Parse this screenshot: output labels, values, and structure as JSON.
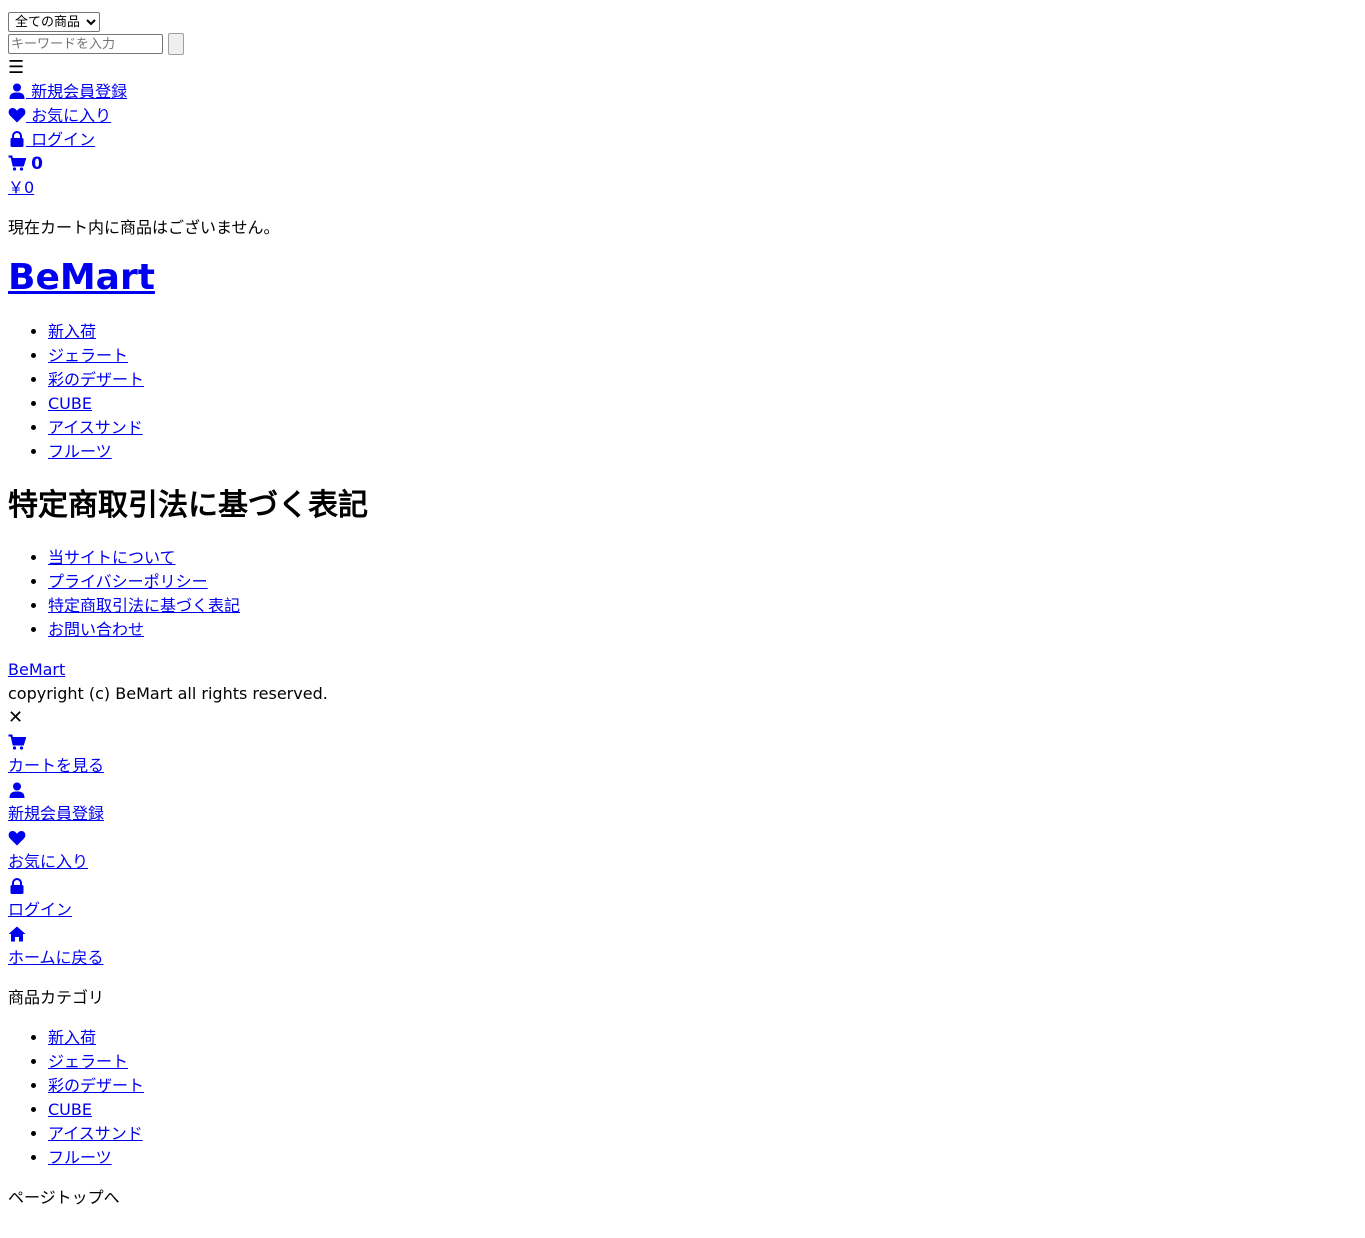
{
  "colors": {
    "link": "#0000ee",
    "text": "#000000",
    "background": "#ffffff"
  },
  "search": {
    "category_selected": "全ての商品",
    "placeholder": "キーワードを入力"
  },
  "header": {
    "menu_glyph": "☰",
    "register_label": "新規会員登録",
    "favorite_label": "お気に入り",
    "login_label": "ログイン",
    "cart_count": "0",
    "cart_total": "￥0",
    "cart_empty_message": "現在カート内に商品はございません。"
  },
  "site": {
    "logo": "BeMart"
  },
  "categories": [
    {
      "label": "新入荷"
    },
    {
      "label": "ジェラート"
    },
    {
      "label": "彩のデザート"
    },
    {
      "label": "CUBE"
    },
    {
      "label": "アイスサンド"
    },
    {
      "label": "フルーツ"
    }
  ],
  "page": {
    "heading": "特定商取引法に基づく表記"
  },
  "footer": {
    "links": [
      {
        "label": "当サイトについて"
      },
      {
        "label": "プライバシーポリシー"
      },
      {
        "label": "特定商取引法に基づく表記"
      },
      {
        "label": "お問い合わせ"
      }
    ],
    "logo": "BeMart",
    "copyright": "copyright (c) BeMart all rights reserved."
  },
  "drawer": {
    "close_glyph": "✕",
    "items": [
      {
        "icon": "cart-icon",
        "label": "カートを見る"
      },
      {
        "icon": "user-icon",
        "label": "新規会員登録"
      },
      {
        "icon": "heart-icon",
        "label": "お気に入り"
      },
      {
        "icon": "lock-icon",
        "label": "ログイン"
      },
      {
        "icon": "home-icon",
        "label": "ホームに戻る"
      }
    ],
    "category_title": "商品カテゴリ"
  },
  "pagetop": {
    "label": "ページトップへ"
  }
}
